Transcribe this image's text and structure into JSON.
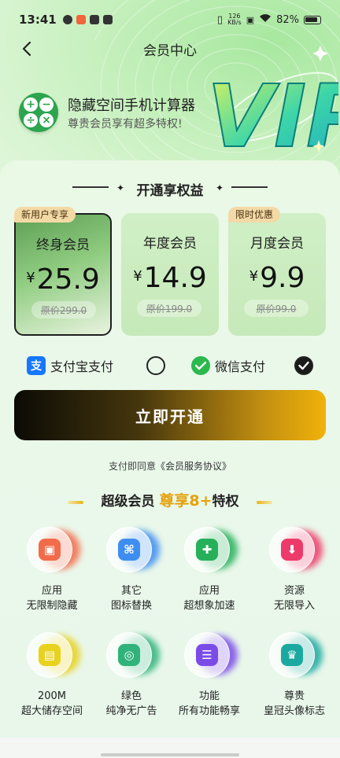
{
  "status_bar": {
    "time": "13:41",
    "net_speed_top": "126",
    "net_speed_bottom": "KB/s",
    "battery": "82%"
  },
  "nav": {
    "title": "会员中心"
  },
  "app": {
    "name": "隐藏空间手机计算器",
    "subtitle": "尊贵会员享有超多特权!"
  },
  "vip_art_text": "VIP",
  "section_title": "开通享权益",
  "plans": [
    {
      "tag": "新用户专享",
      "name": "终身会员",
      "currency": "¥",
      "price": "25.9",
      "original": "原价299.0",
      "selected": true
    },
    {
      "tag": "",
      "name": "年度会员",
      "currency": "¥",
      "price": "14.9",
      "original": "原价199.0",
      "selected": false
    },
    {
      "tag": "限时优惠",
      "name": "月度会员",
      "currency": "¥",
      "price": "9.9",
      "original": "原价99.0",
      "selected": false
    }
  ],
  "payment": {
    "alipay_label": "支付宝支付",
    "alipay_icon_text": "支",
    "wechat_label": "微信支付",
    "selected": "wechat"
  },
  "cta_label": "立即开通",
  "agreement": {
    "prefix": "支付即同意",
    "link": "《会员服务协议》"
  },
  "privileges": {
    "prefix": "超级会员",
    "highlight": "尊享8+",
    "suffix": "特权",
    "items": [
      {
        "icon": "box-icon",
        "line1": "应用",
        "line2": "无限制隐藏",
        "color": "#f26b4a"
      },
      {
        "icon": "command-icon",
        "line1": "其它",
        "line2": "图标替换",
        "color": "#3d8ef0"
      },
      {
        "icon": "gamepad-icon",
        "line1": "应用",
        "line2": "超想象加速",
        "color": "#27b05a"
      },
      {
        "icon": "download-icon",
        "line1": "资源",
        "line2": "无限导入",
        "color": "#ee3a6a"
      },
      {
        "icon": "archive-icon",
        "line1": "200M",
        "line2": "超大储存空间",
        "color": "#e8d21e"
      },
      {
        "icon": "safe-icon",
        "line1": "绿色",
        "line2": "纯净无广告",
        "color": "#2fb37a"
      },
      {
        "icon": "grid-list-icon",
        "line1": "功能",
        "line2": "所有功能畅享",
        "color": "#7b4be8"
      },
      {
        "icon": "crown-icon",
        "line1": "尊贵",
        "line2": "皇冠头像标志",
        "color": "#1ba8a0"
      }
    ]
  }
}
